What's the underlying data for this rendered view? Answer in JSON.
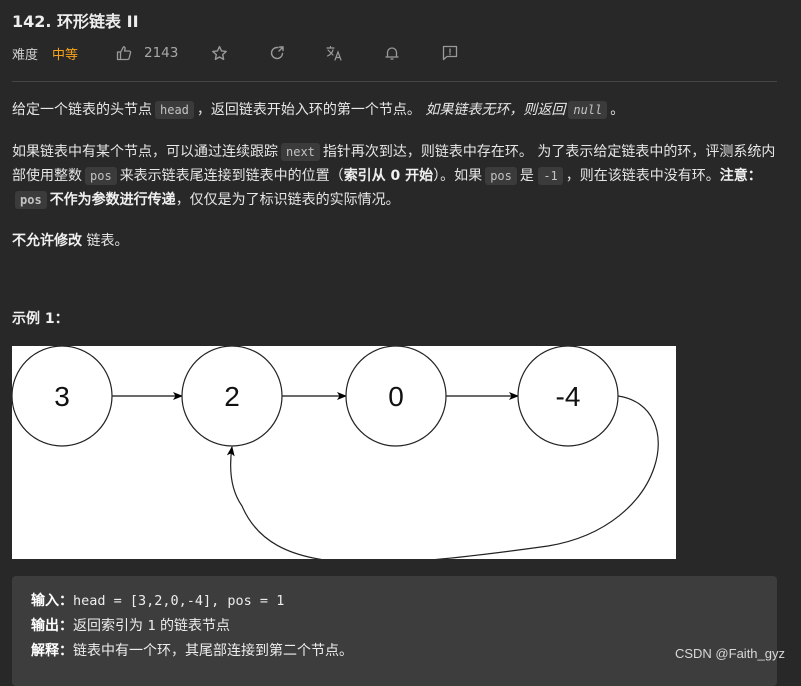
{
  "problem": {
    "title": "142. 环形链表 II",
    "difficulty_label": "难度",
    "difficulty": "中等",
    "difficulty_color": "#f7a21b",
    "likes": "2143",
    "toolbar_icons": [
      "thumbs-up-icon",
      "star-icon",
      "share-icon",
      "translate-icon",
      "bell-icon",
      "feedback-icon"
    ]
  },
  "description": {
    "p1": {
      "t1": "给定一个链表的头节点",
      "c1": "head",
      "t2": "，返回链表开始入环的第一个节点。",
      "em1": "如果链表无环，则返回",
      "c2": "null",
      "t3": "。"
    },
    "p2": {
      "t1": "如果链表中有某个节点，可以通过连续跟踪",
      "c1": "next",
      "t2": "指针再次到达，则链表中存在环。 为了表示给定链表中的环，评测系统内部使用整数",
      "c2": "pos",
      "t3": "来表示链表尾连接到链表中的位置（",
      "b1": "索引从 0 开始",
      "t4": "）。如果",
      "c3": "pos",
      "t5": "是",
      "c4": "-1",
      "t6": "，则在该链表中没有环。",
      "b2": "注意：",
      "c5": "pos",
      "b3": "不作为参数进行传递",
      "t7": "，仅仅是为了标识链表的实际情况。"
    },
    "p3": {
      "b1": "不允许修改",
      "t1": "链表。"
    }
  },
  "example": {
    "heading": "示例 1：",
    "diagram": {
      "nodes": [
        "3",
        "2",
        "0",
        "-4"
      ],
      "cycle_target_index": 1
    },
    "input_label": "输入：",
    "input_value": "head = [3,2,0,-4], pos = 1",
    "output_label": "输出：",
    "output_t1": "返回索引为",
    "output_code": "1",
    "output_t2": "的链表节点",
    "explain_label": "解释：",
    "explain_value": "链表中有一个环，其尾部连接到第二个节点。"
  },
  "watermark": "CSDN @Faith_gyz"
}
